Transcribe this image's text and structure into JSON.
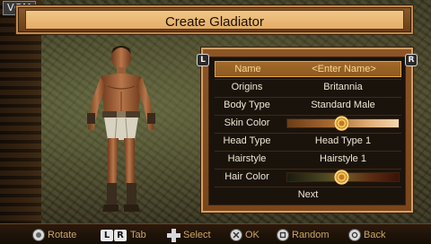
{
  "watermark": "VGM",
  "title": "Create Gladiator",
  "menu": {
    "shoulder_left": "L",
    "shoulder_right": "R",
    "rows": [
      {
        "label": "Name",
        "value": "<Enter Name>"
      },
      {
        "label": "Origins",
        "value": "Britannia"
      },
      {
        "label": "Body Type",
        "value": "Standard Male"
      },
      {
        "label": "Skin Color",
        "slider": 0.48
      },
      {
        "label": "Head Type",
        "value": "Head Type 1"
      },
      {
        "label": "Hairstyle",
        "value": "Hairstyle 1"
      },
      {
        "label": "Hair Color",
        "slider": 0.48
      },
      {
        "label": "Next"
      }
    ],
    "selected_index": 0
  },
  "controls": [
    {
      "icon": "analog-stick-icon",
      "label": "Rotate"
    },
    {
      "icon": "lr-shoulder-buttons-icon",
      "keys": [
        "L",
        "R"
      ],
      "label": "Tab"
    },
    {
      "icon": "dpad-icon",
      "label": "Select"
    },
    {
      "icon": "cross-button-icon",
      "label": "OK"
    },
    {
      "icon": "square-button-icon",
      "label": "Random"
    },
    {
      "icon": "circle-button-icon",
      "label": "Back"
    }
  ],
  "colors": {
    "accent": "#e3ad66",
    "selected_row": "#a26a2a",
    "hint_text": "#c9a56a"
  }
}
